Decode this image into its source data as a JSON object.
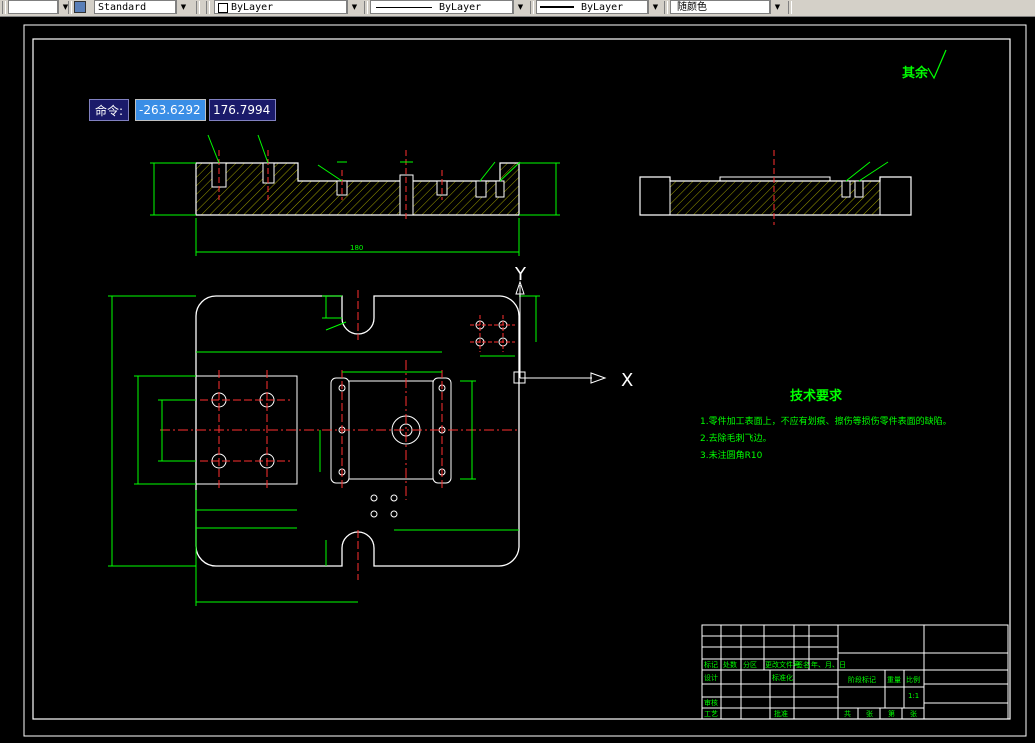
{
  "toolbar": {
    "style_value": "Standard",
    "layer_value": "ByLayer",
    "linetype_value": "ByLayer",
    "lineweight_value": "ByLayer",
    "color_value": "随颜色"
  },
  "command_input": {
    "label": "命令:",
    "x_value": "-263.6292",
    "y_value": "176.7994"
  },
  "drawing": {
    "surface_mark": "其余",
    "ucs_x": "X",
    "ucs_y": "Y",
    "dim_length": "180",
    "tech_title": "技术要求",
    "tech_notes": [
      "1.零件加工表面上，不应有划痕、擦伤等损伤零件表面的缺陷。",
      "2.去除毛刺飞边。",
      "3.未注圆角R10"
    ]
  },
  "title_block": {
    "row_headers": [
      "标记",
      "处数",
      "分区",
      "更改文件号",
      "签名",
      "年、月、日"
    ],
    "row_design": [
      "设计",
      "标准化"
    ],
    "row_review": "审核",
    "row_process": [
      "工艺",
      "批准"
    ],
    "stage_label": "阶段标记",
    "weight_label": "重量",
    "scale_label": "比例",
    "scale_value": "1:1",
    "sheet_labels": [
      "共",
      "张",
      "第",
      "张"
    ]
  },
  "colors": {
    "background": "#000000",
    "outline": "#ffffff",
    "dimension": "#00ff00",
    "center": "#ff3030",
    "hatch": "#ffff00"
  }
}
